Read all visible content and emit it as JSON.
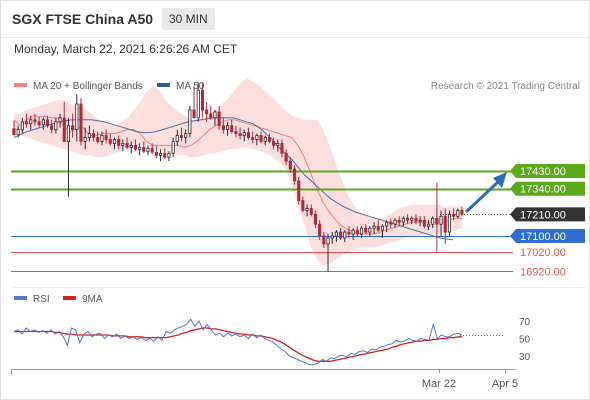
{
  "header": {
    "title": "SGX FTSE China A50",
    "timeframe": "30 MIN",
    "datetime": "Monday, March 22, 2021 6:26:26 AM CET"
  },
  "legend": {
    "bollinger_label": "MA 20 + Bollinger Bands",
    "ma50_label": "MA 50",
    "credit": "Research © 2021 Trading Central"
  },
  "rsi_legend": {
    "rsi_label": "RSI",
    "ma9_label": "9MA"
  },
  "colors": {
    "up_candle": "#2b2b2b",
    "down_candle": "#b0283c",
    "ma20": "#f08080",
    "bollinger_fill": "#fcdada",
    "ma50": "#2f5c9a",
    "resistance": "#5aaa1c",
    "support": "#2f6dd4",
    "target": "#e85050",
    "current_price": "#333333",
    "arrow": "#2f6db8"
  },
  "chart_data": {
    "type": "candlestick",
    "title": "SGX FTSE China A50",
    "timeframe": "30 MIN",
    "x_ticks": [
      "Mar 22",
      "Apr 5"
    ],
    "price_levels": [
      {
        "label": "17430.00",
        "value": 17430,
        "kind": "resistance"
      },
      {
        "label": "17340.00",
        "value": 17340,
        "kind": "resistance"
      },
      {
        "label": "17210.00",
        "value": 17210,
        "kind": "current"
      },
      {
        "label": "17100.00",
        "value": 17100,
        "kind": "support"
      },
      {
        "label": "17020.00",
        "value": 17020,
        "kind": "target"
      },
      {
        "label": "16920.00",
        "value": 16920,
        "kind": "target"
      }
    ],
    "ohlc": [
      [
        17645,
        17685,
        17610,
        17615
      ],
      [
        17615,
        17660,
        17600,
        17640
      ],
      [
        17640,
        17700,
        17620,
        17680
      ],
      [
        17680,
        17720,
        17650,
        17670
      ],
      [
        17670,
        17710,
        17640,
        17690
      ],
      [
        17690,
        17720,
        17660,
        17680
      ],
      [
        17680,
        17705,
        17650,
        17665
      ],
      [
        17665,
        17700,
        17640,
        17690
      ],
      [
        17690,
        17710,
        17650,
        17660
      ],
      [
        17660,
        17690,
        17620,
        17640
      ],
      [
        17640,
        17700,
        17620,
        17680
      ],
      [
        17680,
        17720,
        17650,
        17700
      ],
      [
        17700,
        17780,
        17600,
        17580
      ],
      [
        17580,
        17700,
        17300,
        17660
      ],
      [
        17660,
        17720,
        17600,
        17640
      ],
      [
        17640,
        17820,
        17580,
        17770
      ],
      [
        17770,
        17800,
        17560,
        17580
      ],
      [
        17580,
        17650,
        17540,
        17600
      ],
      [
        17600,
        17660,
        17580,
        17620
      ],
      [
        17620,
        17640,
        17580,
        17600
      ],
      [
        17600,
        17630,
        17570,
        17580
      ],
      [
        17580,
        17630,
        17560,
        17610
      ],
      [
        17610,
        17640,
        17570,
        17590
      ],
      [
        17590,
        17620,
        17560,
        17570
      ],
      [
        17570,
        17600,
        17540,
        17590
      ],
      [
        17590,
        17610,
        17540,
        17560
      ],
      [
        17560,
        17590,
        17530,
        17570
      ],
      [
        17570,
        17600,
        17540,
        17550
      ],
      [
        17550,
        17580,
        17520,
        17560
      ],
      [
        17560,
        17590,
        17530,
        17540
      ],
      [
        17540,
        17570,
        17510,
        17550
      ],
      [
        17550,
        17580,
        17520,
        17530
      ],
      [
        17530,
        17560,
        17510,
        17545
      ],
      [
        17545,
        17570,
        17515,
        17525
      ],
      [
        17525,
        17555,
        17495,
        17510
      ],
      [
        17510,
        17540,
        17480,
        17520
      ],
      [
        17520,
        17545,
        17490,
        17500
      ],
      [
        17500,
        17530,
        17480,
        17520
      ],
      [
        17520,
        17600,
        17500,
        17580
      ],
      [
        17580,
        17640,
        17560,
        17610
      ],
      [
        17610,
        17650,
        17580,
        17600
      ],
      [
        17600,
        17640,
        17570,
        17620
      ],
      [
        17620,
        17760,
        17600,
        17740
      ],
      [
        17740,
        17860,
        17720,
        17700
      ],
      [
        17700,
        17880,
        17680,
        17840
      ],
      [
        17840,
        17880,
        17700,
        17740
      ],
      [
        17740,
        17780,
        17680,
        17720
      ],
      [
        17720,
        17760,
        17690,
        17700
      ],
      [
        17700,
        17740,
        17660,
        17730
      ],
      [
        17730,
        17760,
        17640,
        17660
      ],
      [
        17660,
        17700,
        17620,
        17640
      ],
      [
        17640,
        17680,
        17610,
        17660
      ],
      [
        17660,
        17690,
        17620,
        17630
      ],
      [
        17630,
        17660,
        17600,
        17620
      ],
      [
        17620,
        17650,
        17590,
        17610
      ],
      [
        17610,
        17640,
        17580,
        17625
      ],
      [
        17625,
        17650,
        17590,
        17600
      ],
      [
        17600,
        17630,
        17570,
        17590
      ],
      [
        17590,
        17620,
        17560,
        17610
      ],
      [
        17610,
        17630,
        17570,
        17580
      ],
      [
        17580,
        17610,
        17560,
        17600
      ],
      [
        17600,
        17620,
        17570,
        17580
      ],
      [
        17580,
        17600,
        17540,
        17560
      ],
      [
        17560,
        17590,
        17530,
        17570
      ],
      [
        17570,
        17590,
        17500,
        17520
      ],
      [
        17520,
        17540,
        17460,
        17480
      ],
      [
        17480,
        17500,
        17420,
        17440
      ],
      [
        17440,
        17460,
        17360,
        17380
      ],
      [
        17380,
        17400,
        17260,
        17280
      ],
      [
        17280,
        17300,
        17220,
        17230
      ],
      [
        17230,
        17260,
        17200,
        17240
      ],
      [
        17240,
        17260,
        17200,
        17210
      ],
      [
        17210,
        17230,
        17140,
        17160
      ],
      [
        17160,
        17180,
        17080,
        17100
      ],
      [
        17100,
        17120,
        17040,
        17060
      ],
      [
        17060,
        17110,
        16920,
        17090
      ],
      [
        17090,
        17120,
        17060,
        17100
      ],
      [
        17100,
        17130,
        17070,
        17120
      ],
      [
        17120,
        17140,
        17080,
        17090
      ],
      [
        17090,
        17130,
        17070,
        17120
      ],
      [
        17120,
        17150,
        17090,
        17110
      ],
      [
        17110,
        17140,
        17080,
        17130
      ],
      [
        17130,
        17150,
        17100,
        17110
      ],
      [
        17110,
        17150,
        17090,
        17140
      ],
      [
        17140,
        17160,
        17110,
        17120
      ],
      [
        17120,
        17150,
        17100,
        17140
      ],
      [
        17140,
        17170,
        17110,
        17150
      ],
      [
        17150,
        17180,
        17120,
        17130
      ],
      [
        17130,
        17160,
        17090,
        17150
      ],
      [
        17150,
        17180,
        17120,
        17170
      ],
      [
        17170,
        17190,
        17140,
        17160
      ],
      [
        17160,
        17190,
        17140,
        17180
      ],
      [
        17180,
        17200,
        17150,
        17170
      ],
      [
        17170,
        17200,
        17150,
        17190
      ],
      [
        17190,
        17210,
        17160,
        17180
      ],
      [
        17180,
        17200,
        17160,
        17190
      ],
      [
        17190,
        17210,
        17160,
        17175
      ],
      [
        17175,
        17200,
        17150,
        17180
      ],
      [
        17180,
        17200,
        17140,
        17150
      ],
      [
        17150,
        17180,
        17130,
        17160
      ],
      [
        17160,
        17200,
        17140,
        17190
      ],
      [
        17190,
        17370,
        17020,
        17160
      ],
      [
        17160,
        17230,
        17100,
        17200
      ],
      [
        17200,
        17240,
        17060,
        17120
      ],
      [
        17120,
        17230,
        17100,
        17210
      ],
      [
        17210,
        17240,
        17180,
        17200
      ],
      [
        17200,
        17240,
        17190,
        17230
      ],
      [
        17230,
        17250,
        17200,
        17210
      ]
    ],
    "ma20": [
      17690,
      17660,
      17690,
      17710,
      17705,
      17705,
      17700,
      17700,
      17650,
      17630,
      17650,
      17650,
      17610,
      17610,
      17620,
      17620,
      17620,
      17630,
      17640,
      17640,
      17620,
      17580,
      17560,
      17560,
      17560,
      17560,
      17560,
      17550,
      17560,
      17580,
      17610,
      17640,
      17660,
      17680,
      17690,
      17690,
      17680,
      17670,
      17660,
      17650,
      17640,
      17630,
      17620,
      17610,
      17600,
      17560,
      17500,
      17420,
      17340,
      17270,
      17220,
      17180,
      17150,
      17130,
      17120,
      17110,
      17110,
      17110,
      17120,
      17130,
      17140,
      17150,
      17160,
      17170,
      17170,
      17170,
      17170,
      17170,
      17170,
      17180,
      17190,
      17190
    ],
    "bollinger_upper": [
      17720,
      17720,
      17740,
      17750,
      17760,
      17770,
      17780,
      17790,
      17790,
      17770,
      17760,
      17750,
      17730,
      17700,
      17680,
      17670,
      17660,
      17680,
      17700,
      17740,
      17780,
      17830,
      17860,
      17840,
      17790,
      17760,
      17730,
      17710,
      17690,
      17690,
      17700,
      17720,
      17740,
      17770,
      17800,
      17840,
      17880,
      17900,
      17880,
      17860,
      17830,
      17800,
      17770,
      17740,
      17710,
      17700,
      17690,
      17690,
      17690,
      17640,
      17560,
      17470,
      17380,
      17300,
      17250,
      17220,
      17200,
      17190,
      17190,
      17200,
      17220,
      17240,
      17250,
      17260,
      17260,
      17260,
      17260,
      17260,
      17250,
      17250,
      17250,
      17250
    ],
    "bollinger_lower": [
      17640,
      17620,
      17600,
      17590,
      17580,
      17570,
      17560,
      17550,
      17540,
      17530,
      17520,
      17510,
      17510,
      17500,
      17500,
      17510,
      17520,
      17530,
      17540,
      17550,
      17560,
      17560,
      17550,
      17540,
      17530,
      17520,
      17510,
      17510,
      17500,
      17500,
      17510,
      17520,
      17520,
      17530,
      17540,
      17540,
      17550,
      17550,
      17540,
      17530,
      17520,
      17500,
      17480,
      17440,
      17360,
      17260,
      17160,
      17050,
      16980,
      16950,
      16960,
      16980,
      17000,
      17020,
      17030,
      17040,
      17040,
      17040,
      17050,
      17060,
      17070,
      17080,
      17090,
      17100,
      17100,
      17110,
      17110,
      17110,
      17120,
      17120,
      17130,
      17140
    ],
    "ma50": [
      17600,
      17615,
      17630,
      17640,
      17650,
      17660,
      17670,
      17680,
      17685,
      17690,
      17690,
      17690,
      17690,
      17685,
      17680,
      17670,
      17660,
      17650,
      17640,
      17630,
      17625,
      17625,
      17630,
      17640,
      17650,
      17660,
      17670,
      17680,
      17685,
      17690,
      17695,
      17700,
      17700,
      17700,
      17700,
      17690,
      17680,
      17670,
      17650,
      17620,
      17590,
      17550,
      17520,
      17490,
      17450,
      17410,
      17380,
      17350,
      17320,
      17290,
      17270,
      17250,
      17235,
      17220,
      17210,
      17200,
      17190,
      17180,
      17170,
      17160,
      17150,
      17140,
      17130,
      17120,
      17110,
      17100,
      17090,
      17085,
      17080
    ],
    "rsi_axis_ticks": [
      70,
      50,
      30
    ],
    "rsi_ylim": [
      10,
      80
    ],
    "rsi": [
      58,
      60,
      55,
      62,
      58,
      60,
      57,
      59,
      56,
      60,
      55,
      58,
      52,
      42,
      62,
      60,
      45,
      55,
      58,
      52,
      55,
      56,
      50,
      54,
      52,
      55,
      50,
      53,
      50,
      52,
      49,
      51,
      48,
      50,
      47,
      52,
      48,
      58,
      56,
      60,
      62,
      64,
      66,
      72,
      64,
      70,
      60,
      66,
      60,
      54,
      56,
      52,
      56,
      53,
      55,
      52,
      54,
      50,
      55,
      51,
      54,
      50,
      48,
      46,
      42,
      38,
      35,
      30,
      28,
      26,
      24,
      22,
      20,
      20,
      22,
      26,
      24,
      28,
      27,
      30,
      31,
      29,
      33,
      32,
      35,
      36,
      34,
      38,
      37,
      40,
      41,
      43,
      44,
      48,
      46,
      47,
      50,
      48,
      47,
      50,
      49,
      48,
      66,
      50,
      54,
      52,
      52,
      55,
      56,
      54
    ],
    "rsi_ma9": [
      58,
      58,
      58,
      58,
      58,
      58,
      58,
      58,
      58,
      58,
      57,
      57,
      56,
      55,
      55,
      54,
      54,
      54,
      54,
      54,
      54,
      54,
      54,
      54,
      53,
      53,
      53,
      53,
      52,
      52,
      52,
      52,
      51,
      51,
      51,
      51,
      51,
      51,
      52,
      53,
      54,
      56,
      57,
      59,
      60,
      61,
      62,
      62,
      61,
      61,
      60,
      59,
      58,
      57,
      56,
      55,
      55,
      54,
      54,
      53,
      53,
      52,
      51,
      50,
      48,
      46,
      43,
      40,
      37,
      34,
      31,
      29,
      27,
      25,
      24,
      24,
      24,
      24,
      25,
      26,
      27,
      28,
      29,
      30,
      31,
      32,
      33,
      34,
      35,
      36,
      37,
      38,
      40,
      41,
      43,
      44,
      45,
      46,
      47,
      47,
      48,
      48,
      49,
      49,
      50,
      50,
      51,
      51,
      52,
      52
    ]
  }
}
